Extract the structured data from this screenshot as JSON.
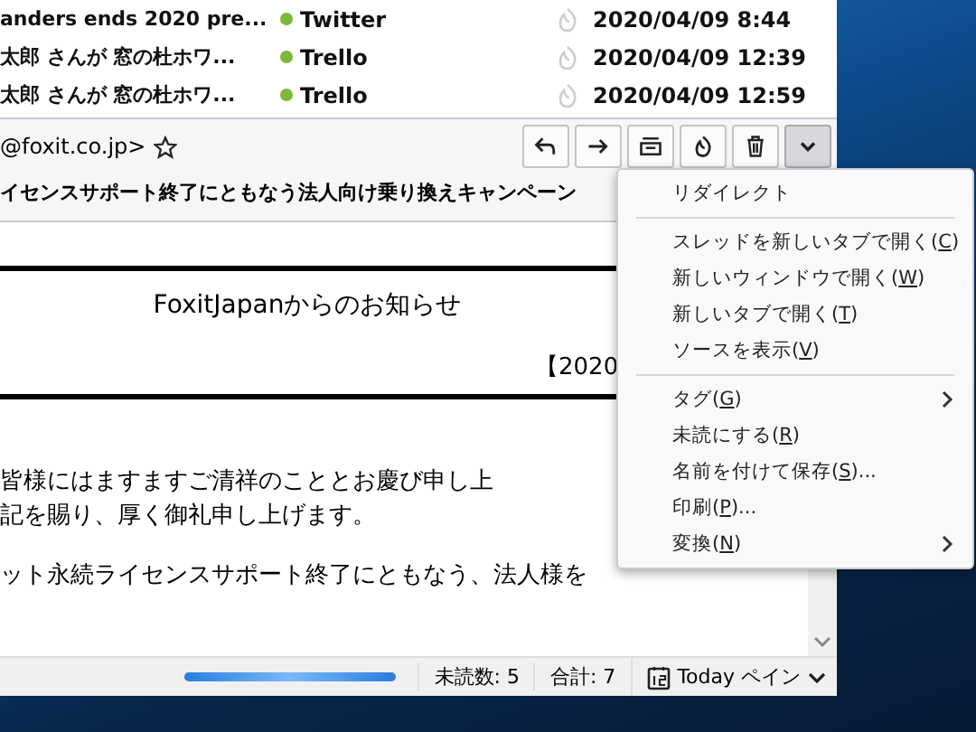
{
  "message_list": [
    {
      "subject": "anders ends 2020 pre...",
      "unread": true,
      "sender": "Twitter",
      "date": "2020/04/09 8:44"
    },
    {
      "subject": "太郎 さんが 窓の杜ホワ...",
      "unread": true,
      "sender": "Trello",
      "date": "2020/04/09 12:39"
    },
    {
      "subject": "太郎 さんが 窓の杜ホワ...",
      "unread": true,
      "sender": "Trello",
      "date": "2020/04/09 12:59"
    }
  ],
  "header": {
    "from": "@foxit.co.jp>",
    "starred": false,
    "subject": "イセンスサポート終了にともなう法人向け乗り換えキャンペーン",
    "toolbar": [
      {
        "kind": "reply",
        "pressed": false
      },
      {
        "kind": "forward",
        "pressed": false
      },
      {
        "kind": "archive",
        "pressed": false
      },
      {
        "kind": "junk",
        "pressed": false
      },
      {
        "kind": "delete",
        "pressed": false
      },
      {
        "kind": "more",
        "pressed": true
      }
    ]
  },
  "body": {
    "banner_title": "FoxitJapanからのお知らせ",
    "banner_date": "【2020",
    "paragraphs": [
      [
        "皆様にはますますご清祥のこととお慶び申し上",
        "記を賜り、厚く御礼申し上げます。"
      ],
      [
        "ット永続ライセンスサポート終了にともなう、法人様を"
      ]
    ]
  },
  "context_menu": [
    {
      "kind": "item",
      "before": "リダイレクト",
      "submenu": false
    },
    {
      "kind": "separator"
    },
    {
      "kind": "item",
      "before": "スレッドを新しいタブで開く(",
      "key": "C",
      "after": ")",
      "submenu": false
    },
    {
      "kind": "item",
      "before": "新しいウィンドウで開く(",
      "key": "W",
      "after": ")",
      "submenu": false
    },
    {
      "kind": "item",
      "before": "新しいタブで開く(",
      "key": "T",
      "after": ")",
      "submenu": false
    },
    {
      "kind": "item",
      "before": "ソースを表示(",
      "key": "V",
      "after": ")",
      "submenu": false
    },
    {
      "kind": "separator"
    },
    {
      "kind": "item",
      "before": "タグ(",
      "key": "G",
      "after": ")",
      "submenu": true
    },
    {
      "kind": "item",
      "before": "未読にする(",
      "key": "R",
      "after": ")",
      "submenu": false
    },
    {
      "kind": "item",
      "before": "名前を付けて保存(",
      "key": "S",
      "after": ")...",
      "submenu": false
    },
    {
      "kind": "item",
      "before": "印刷(",
      "key": "P",
      "after": ")...",
      "submenu": false
    },
    {
      "kind": "item",
      "before": "変換(",
      "key": "N",
      "after": ")",
      "submenu": true
    }
  ],
  "status_bar": {
    "progress": {
      "level": 1
    },
    "unread": "未読数: 5",
    "total": "合計: 7",
    "today_pane": "Today ペイン"
  }
}
